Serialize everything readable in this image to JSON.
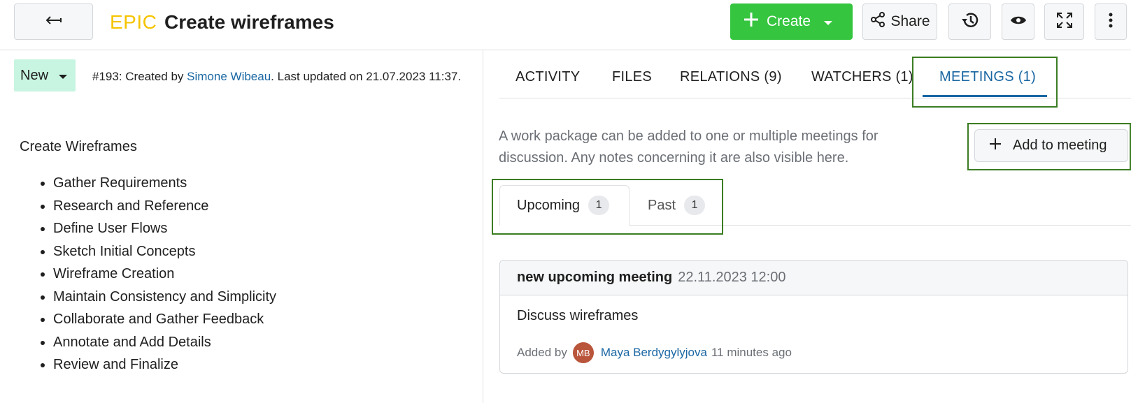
{
  "header": {
    "type_label": "EPIC",
    "title": "Create wireframes",
    "create_label": "Create",
    "share_label": "Share",
    "icons": {
      "back": "back-arrow-icon",
      "create_plus": "plus-icon",
      "create_caret": "caret-down-icon",
      "share": "share-icon",
      "history": "history-icon",
      "watch": "eye-icon",
      "fullscreen": "fullscreen-icon",
      "more": "kebab-menu-icon"
    },
    "colors": {
      "type_label": "#f5c400",
      "create": "#35c53f"
    }
  },
  "left": {
    "status": "New",
    "meta": {
      "prefix": "#193: Created by ",
      "author": "Simone Wibeau",
      "suffix": ". Last updated on 21.07.2023 11:37."
    },
    "description_title": "Create Wireframes",
    "description_items": [
      "Gather Requirements",
      "Research and Reference",
      "Define User Flows",
      "Sketch Initial Concepts",
      "Wireframe Creation",
      "Maintain Consistency and Simplicity",
      "Collaborate and Gather Feedback",
      "Annotate and Add Details",
      "Review and Finalize"
    ],
    "colors": {
      "status_bg": "#c7f5e1",
      "link": "#1a67a3"
    }
  },
  "tabs": {
    "activity": "ACTIVITY",
    "files": "FILES",
    "relations": "RELATIONS (9)",
    "watchers": "WATCHERS (1)",
    "meetings": "MEETINGS (1)",
    "active": "meetings"
  },
  "meetings": {
    "info": "A work package can be added to one or multiple meetings for discussion. Any notes concerning it are also visible here.",
    "add_label": "Add to meeting",
    "subtabs": {
      "upcoming": {
        "label": "Upcoming",
        "count": "1"
      },
      "past": {
        "label": "Past",
        "count": "1"
      }
    },
    "card": {
      "name": "new upcoming meeting",
      "datetime": "22.11.2023 12:00",
      "notes": "Discuss wireframes",
      "added_by_label": "Added by",
      "avatar_initials": "MB",
      "user": "Maya Berdygylyjova",
      "time_ago": "11 minutes ago"
    },
    "colors": {
      "highlight": "#3b7d23",
      "avatar": "#b9553b"
    }
  }
}
